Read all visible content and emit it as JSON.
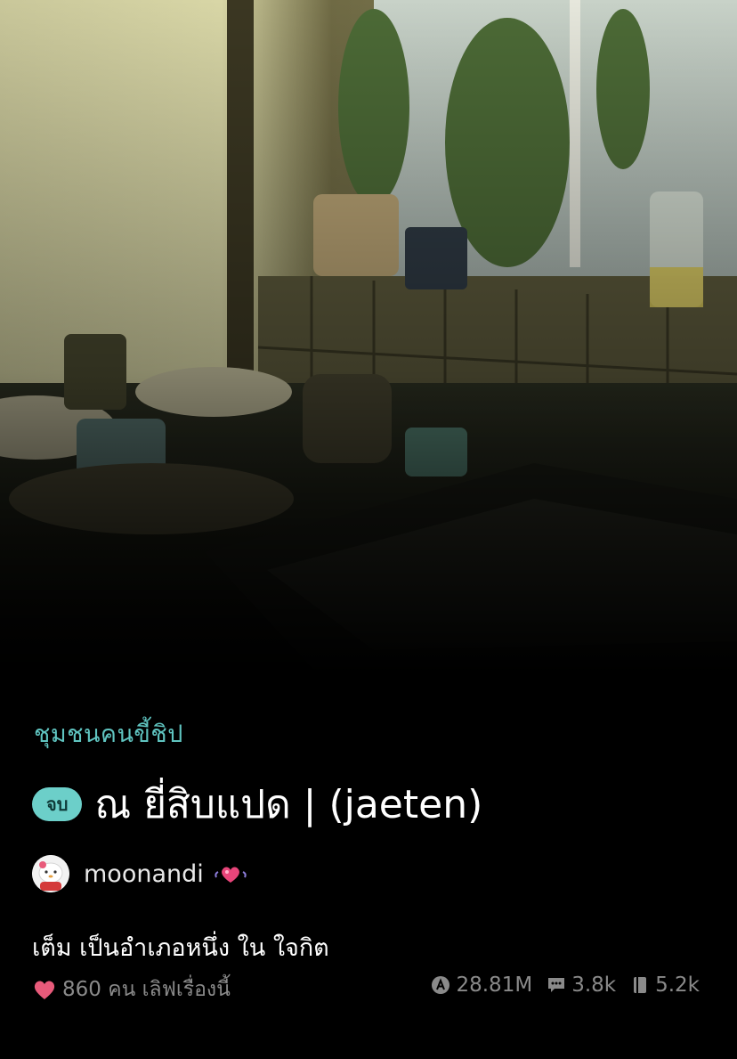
{
  "cover": {
    "icon": "kitchen-window-photo"
  },
  "story": {
    "category": "ชุมชนคนขี้ชิป",
    "status_badge": "จบ",
    "title": "ณ ยี่สิบแปด | (jaeten)",
    "author": "moonandi",
    "description": "เต็ม เป็นอำเภอหนึ่ง ใน ใจกิต"
  },
  "stats": {
    "likes_text": "860 คน เลิฟเรื่องนี้",
    "views": "28.81M",
    "comments": "3.8k",
    "bookmarks": "5.2k"
  },
  "colors": {
    "accent": "#5fc4c0",
    "badge_bg": "#6ccfc9",
    "heart": "#e85a7a",
    "muted": "#8a8a8a"
  }
}
